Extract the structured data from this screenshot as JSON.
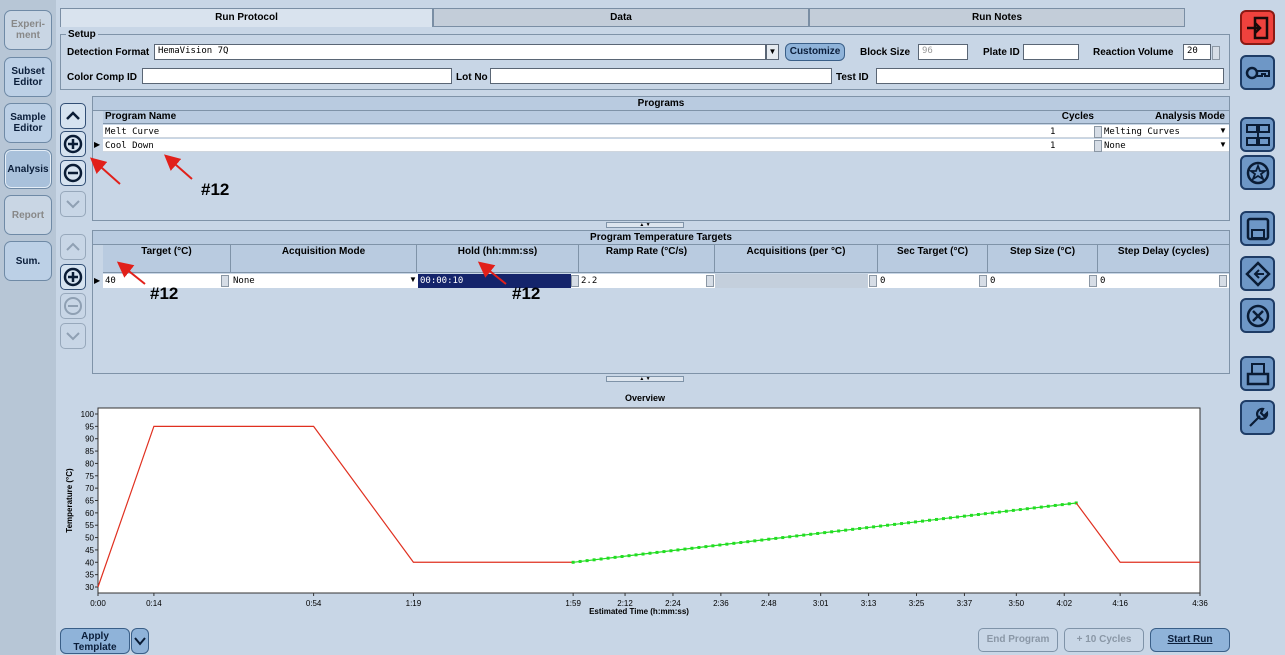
{
  "nav": [
    "Experi-\nment",
    "Subset\nEditor",
    "Sample\nEditor",
    "Analysis",
    "Report",
    "Sum."
  ],
  "tabs": [
    "Run Protocol",
    "Data",
    "Run Notes"
  ],
  "setup": {
    "title": "Setup",
    "detection_label": "Detection Format",
    "detection_value": "HemaVision 7Q",
    "customize": "Customize",
    "block_label": "Block Size",
    "block_value": "96",
    "plate_label": "Plate ID",
    "plate_value": "",
    "volume_label": "Reaction Volume",
    "volume_value": "20",
    "colorcomp_label": "Color Comp ID",
    "lot_label": "Lot No",
    "test_label": "Test ID"
  },
  "programs": {
    "title": "Programs",
    "headers": [
      "Program Name",
      "Cycles",
      "Analysis Mode"
    ],
    "rows": [
      {
        "name": "Melt Curve",
        "cycles": "1",
        "mode": "Melting Curves"
      },
      {
        "name": "Cool Down",
        "cycles": "1",
        "mode": "None"
      }
    ]
  },
  "targets": {
    "title": "Program Temperature Targets",
    "headers": [
      "Target (°C)",
      "Acquisition Mode",
      "Hold (hh:mm:ss)",
      "Ramp Rate (°C/s)",
      "Acquisitions (per °C)",
      "Sec Target (°C)",
      "Step Size (°C)",
      "Step Delay (cycles)"
    ],
    "row": [
      "40",
      "None",
      "00:00:10",
      "2.2",
      "",
      "0",
      "0",
      "0"
    ]
  },
  "annotation": "#12",
  "overview": {
    "title": "Overview"
  },
  "chart_data": {
    "type": "line",
    "title": "Overview",
    "xlabel": "Estimated Time (h:mm:ss)",
    "ylabel": "Temperature (°C)",
    "ylim": [
      30,
      100
    ],
    "yticks": [
      30,
      35,
      40,
      45,
      50,
      55,
      60,
      65,
      70,
      75,
      80,
      85,
      90,
      95,
      100
    ],
    "xticks": [
      "0:00",
      "0:14",
      "0:54",
      "1:19",
      "1:59",
      "2:12",
      "2:24",
      "2:36",
      "2:48",
      "3:01",
      "3:13",
      "3:25",
      "3:37",
      "3:50",
      "4:02",
      "4:16",
      "4:36"
    ],
    "xtick_seconds": [
      0,
      14,
      54,
      79,
      119,
      132,
      144,
      156,
      168,
      181,
      193,
      205,
      217,
      230,
      242,
      256,
      276
    ],
    "series": [
      {
        "color": "#e03020",
        "x": [
          0,
          14,
          54,
          79,
          119
        ],
        "y": [
          30,
          95,
          95,
          40,
          40
        ]
      },
      {
        "color": "#22dd22",
        "x": [
          119,
          245
        ],
        "y": [
          40,
          64
        ],
        "markers": true
      },
      {
        "color": "#e03020",
        "x": [
          245,
          256,
          276
        ],
        "y": [
          64,
          40,
          40
        ]
      }
    ]
  },
  "bottom": {
    "apply_template": "Apply\nTemplate",
    "end_program": "End Program",
    "plus_cycles": "+ 10 Cycles",
    "start_run": "Start Run"
  }
}
